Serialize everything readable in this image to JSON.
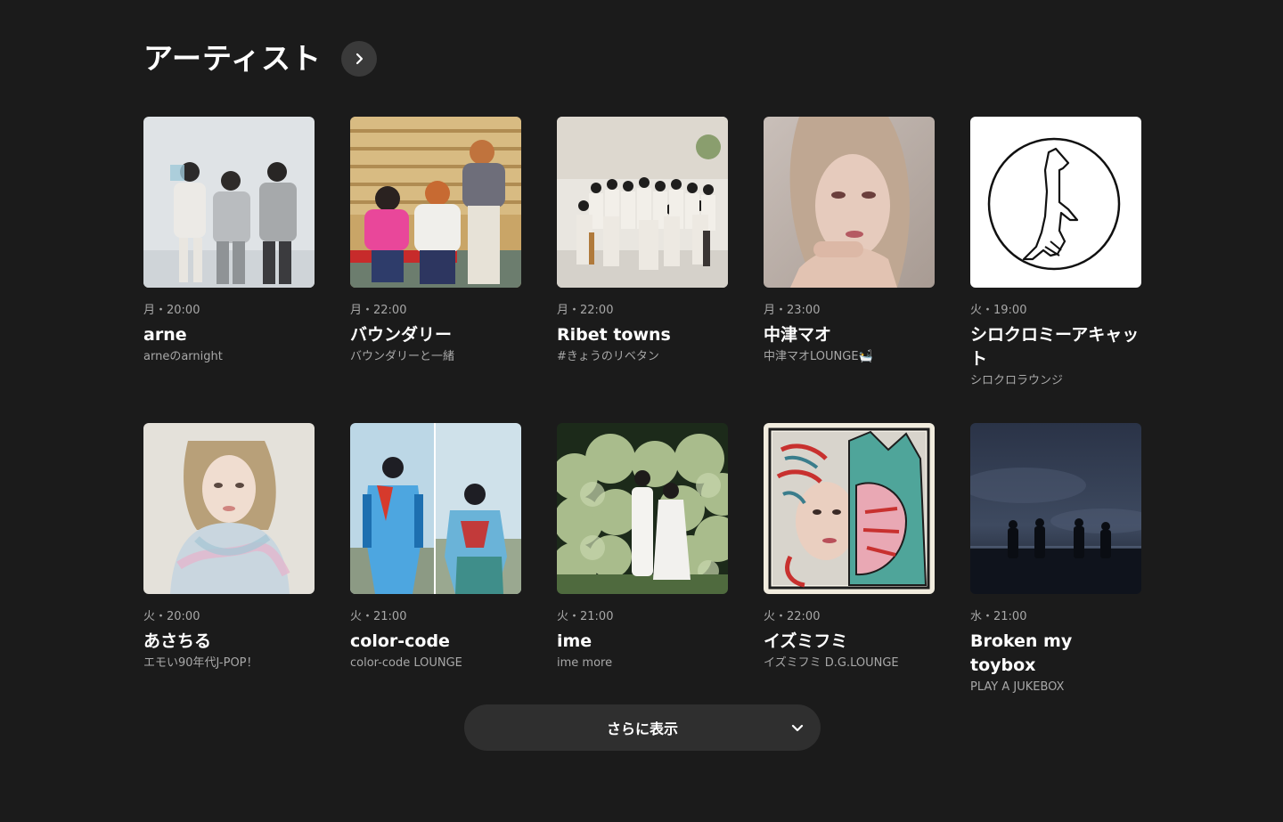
{
  "section": {
    "title": "アーティスト"
  },
  "artists": [
    {
      "schedule": "月・20:00",
      "name": "arne",
      "program": "arneのarnight"
    },
    {
      "schedule": "月・22:00",
      "name": "バウンダリー",
      "program": "バウンダリーと一緒"
    },
    {
      "schedule": "月・22:00",
      "name": "Ribet towns",
      "program": "#きょうのリベタン"
    },
    {
      "schedule": "月・23:00",
      "name": "中津マオ",
      "program": "中津マオLOUNGE🛀"
    },
    {
      "schedule": "火・19:00",
      "name": "シロクロミーアキャット",
      "program": "シロクロラウンジ"
    },
    {
      "schedule": "火・20:00",
      "name": "あさちる",
      "program": "エモい90年代J-POP！"
    },
    {
      "schedule": "火・21:00",
      "name": "color-code",
      "program": "color-code LOUNGE"
    },
    {
      "schedule": "火・21:00",
      "name": "ime",
      "program": "ime more"
    },
    {
      "schedule": "火・22:00",
      "name": "イズミフミ",
      "program": "イズミフミ D.G.LOUNGE"
    },
    {
      "schedule": "水・21:00",
      "name": "Broken my toybox",
      "program": "PLAY A JUKEBOX"
    }
  ],
  "more": {
    "label": "さらに表示"
  },
  "icons": {
    "header_arrow": "chevron-right-icon",
    "more_chevron": "chevron-down-icon"
  },
  "colors": {
    "background": "#1b1b1b",
    "button": "#2f2f2f",
    "muted_text": "#a8a8a8"
  }
}
